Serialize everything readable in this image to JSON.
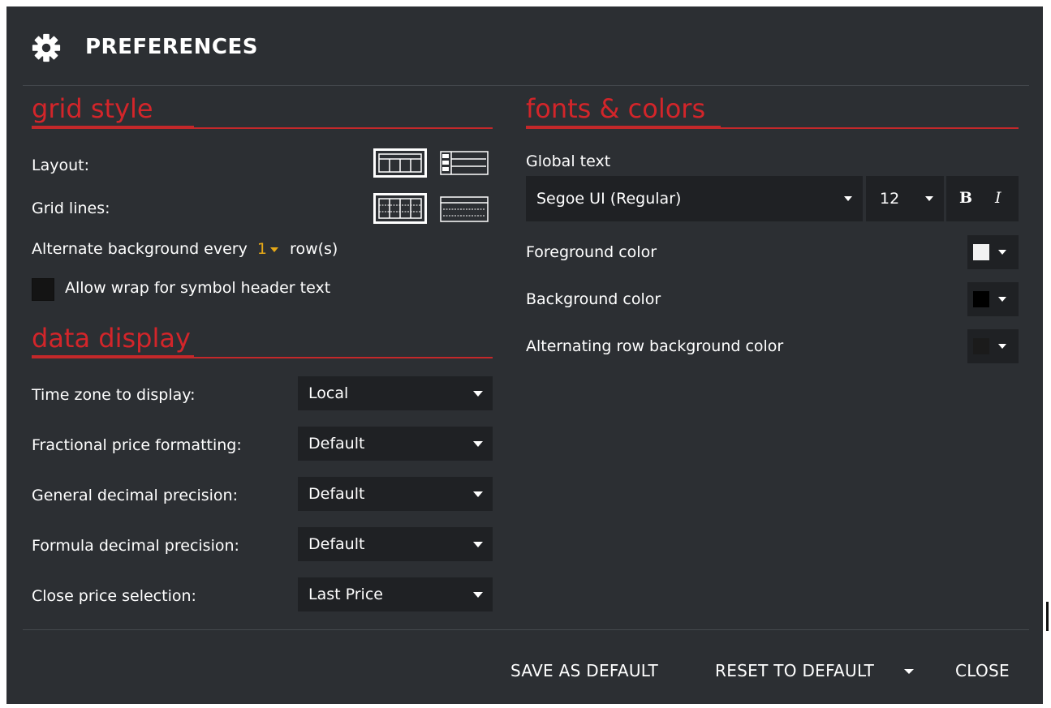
{
  "window": {
    "title": "PREFERENCES",
    "icon": "gear-icon"
  },
  "grid_style": {
    "heading": "grid style",
    "layout_label": "Layout:",
    "layout_options": [
      "grid-layout-icon",
      "list-layout-icon"
    ],
    "grid_lines_label": "Grid lines:",
    "grid_lines_options": [
      "all-lines-icon",
      "horizontal-lines-icon"
    ],
    "alternate_prefix": "Alternate background every",
    "alternate_value": "1",
    "alternate_suffix": "row(s)",
    "wrap_label": "Allow wrap for symbol header text",
    "wrap_checked": false
  },
  "data_display": {
    "heading": "data display",
    "rows": [
      {
        "label": "Time zone to display:",
        "value": "Local"
      },
      {
        "label": "Fractional price formatting:",
        "value": "Default"
      },
      {
        "label": "General decimal precision:",
        "value": "Default"
      },
      {
        "label": "Formula decimal precision:",
        "value": "Default"
      },
      {
        "label": "Close price selection:",
        "value": "Last Price"
      }
    ]
  },
  "fonts_colors": {
    "heading": "fonts & colors",
    "global_text_label": "Global text",
    "font_family": "Segoe UI (Regular)",
    "font_size": "12",
    "bold_label": "B",
    "italic_label": "I",
    "colors": [
      {
        "label": "Foreground color",
        "swatch": "#f2f2f2"
      },
      {
        "label": "Background color",
        "swatch": "#000000"
      },
      {
        "label": "Alternating row background color",
        "swatch": "#1b1b1b"
      }
    ]
  },
  "footer": {
    "save_default": "SAVE AS DEFAULT",
    "reset_default": "RESET TO DEFAULT",
    "close": "CLOSE"
  },
  "colors": {
    "dialog_bg": "#2c2f33",
    "accent_red": "#d3252a",
    "field_bg": "#1f2124",
    "alt_value": "#e6a817"
  }
}
